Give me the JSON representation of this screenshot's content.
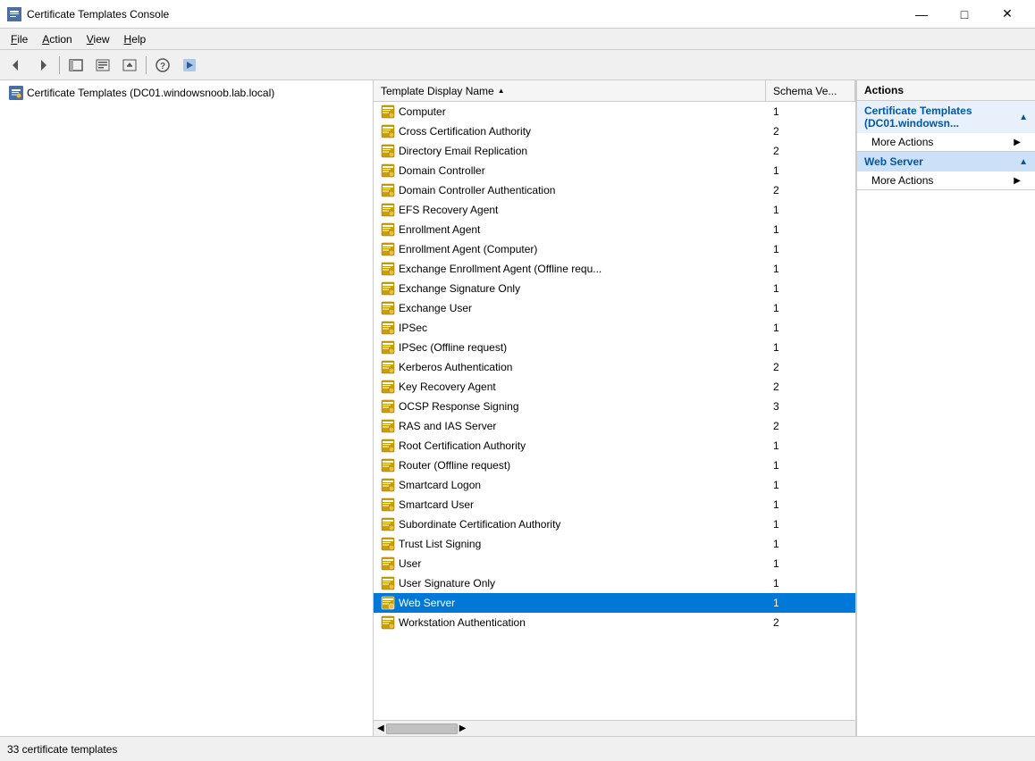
{
  "window": {
    "title": "Certificate Templates Console",
    "icon": "C"
  },
  "menubar": {
    "items": [
      {
        "id": "file",
        "label": "File",
        "underline_idx": 0
      },
      {
        "id": "action",
        "label": "Action",
        "underline_idx": 0
      },
      {
        "id": "view",
        "label": "View",
        "underline_idx": 0
      },
      {
        "id": "help",
        "label": "Help",
        "underline_idx": 0
      }
    ]
  },
  "toolbar": {
    "buttons": [
      {
        "id": "back",
        "symbol": "←",
        "label": "Back"
      },
      {
        "id": "forward",
        "symbol": "→",
        "label": "Forward"
      },
      {
        "id": "up",
        "symbol": "⬆",
        "label": "Up"
      },
      {
        "id": "show-hide",
        "symbol": "▤",
        "label": "Show/Hide"
      },
      {
        "id": "export",
        "symbol": "📤",
        "label": "Export"
      },
      {
        "id": "help",
        "symbol": "?",
        "label": "Help"
      },
      {
        "id": "run",
        "symbol": "▶",
        "label": "Run"
      }
    ]
  },
  "left_pane": {
    "tree": [
      {
        "id": "cert-templates",
        "label": "Certificate Templates (DC01.windowsnoob.lab.local)",
        "icon": "cert-icon"
      }
    ]
  },
  "list_pane": {
    "columns": [
      {
        "id": "name",
        "label": "Template Display Name",
        "sort": "asc"
      },
      {
        "id": "schema",
        "label": "Schema Ve..."
      }
    ],
    "rows": [
      {
        "id": "computer",
        "name": "Computer",
        "schema": "1",
        "selected": false
      },
      {
        "id": "cross-cert-auth",
        "name": "Cross Certification Authority",
        "schema": "2",
        "selected": false
      },
      {
        "id": "dir-email-rep",
        "name": "Directory Email Replication",
        "schema": "2",
        "selected": false
      },
      {
        "id": "domain-ctrl",
        "name": "Domain Controller",
        "schema": "1",
        "selected": false
      },
      {
        "id": "domain-ctrl-auth",
        "name": "Domain Controller Authentication",
        "schema": "2",
        "selected": false
      },
      {
        "id": "efs-recovery",
        "name": "EFS Recovery Agent",
        "schema": "1",
        "selected": false
      },
      {
        "id": "enrollment-agent",
        "name": "Enrollment Agent",
        "schema": "1",
        "selected": false
      },
      {
        "id": "enrollment-agent-comp",
        "name": "Enrollment Agent (Computer)",
        "schema": "1",
        "selected": false
      },
      {
        "id": "exchange-enroll",
        "name": "Exchange Enrollment Agent (Offline requ...",
        "schema": "1",
        "selected": false
      },
      {
        "id": "exchange-sig-only",
        "name": "Exchange Signature Only",
        "schema": "1",
        "selected": false
      },
      {
        "id": "exchange-user",
        "name": "Exchange User",
        "schema": "1",
        "selected": false
      },
      {
        "id": "ipsec",
        "name": "IPSec",
        "schema": "1",
        "selected": false
      },
      {
        "id": "ipsec-offline",
        "name": "IPSec (Offline request)",
        "schema": "1",
        "selected": false
      },
      {
        "id": "kerberos-auth",
        "name": "Kerberos Authentication",
        "schema": "2",
        "selected": false
      },
      {
        "id": "key-recovery",
        "name": "Key Recovery Agent",
        "schema": "2",
        "selected": false
      },
      {
        "id": "ocsp-response",
        "name": "OCSP Response Signing",
        "schema": "3",
        "selected": false
      },
      {
        "id": "ras-ias",
        "name": "RAS and IAS Server",
        "schema": "2",
        "selected": false
      },
      {
        "id": "root-cert-auth",
        "name": "Root Certification Authority",
        "schema": "1",
        "selected": false
      },
      {
        "id": "router-offline",
        "name": "Router (Offline request)",
        "schema": "1",
        "selected": false
      },
      {
        "id": "smartcard-logon",
        "name": "Smartcard Logon",
        "schema": "1",
        "selected": false
      },
      {
        "id": "smartcard-user",
        "name": "Smartcard User",
        "schema": "1",
        "selected": false
      },
      {
        "id": "sub-cert-auth",
        "name": "Subordinate Certification Authority",
        "schema": "1",
        "selected": false
      },
      {
        "id": "trust-list",
        "name": "Trust List Signing",
        "schema": "1",
        "selected": false
      },
      {
        "id": "user",
        "name": "User",
        "schema": "1",
        "selected": false
      },
      {
        "id": "user-sig-only",
        "name": "User Signature Only",
        "schema": "1",
        "selected": false
      },
      {
        "id": "web-server",
        "name": "Web Server",
        "schema": "1",
        "selected": true
      },
      {
        "id": "workstation-auth",
        "name": "Workstation Authentication",
        "schema": "2",
        "selected": false
      }
    ]
  },
  "actions_pane": {
    "title": "Actions",
    "sections": [
      {
        "id": "cert-templates-section",
        "label": "Certificate Templates (DC01.windowsn...",
        "expanded": true,
        "items": [
          {
            "id": "more-actions-1",
            "label": "More Actions"
          }
        ]
      },
      {
        "id": "web-server-section",
        "label": "Web Server",
        "expanded": true,
        "selected": true,
        "items": [
          {
            "id": "more-actions-2",
            "label": "More Actions"
          }
        ]
      }
    ]
  },
  "status_bar": {
    "text": "33 certificate templates"
  },
  "colors": {
    "selected_row_bg": "#0078d7",
    "selected_row_text": "#ffffff",
    "action_section_selected_bg": "#cce0f8",
    "action_section_bg": "#e8f0fb",
    "action_title_color": "#0058a3"
  }
}
